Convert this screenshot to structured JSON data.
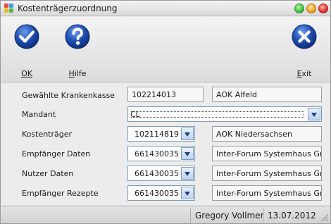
{
  "window": {
    "title": "Kostenträgerzuordnung",
    "controls": [
      "minimize",
      "maximize",
      "close"
    ]
  },
  "toolbar": {
    "ok_label": "OK",
    "help_label": "Hilfe",
    "exit_label": "Exit",
    "ok_icon": "check-icon",
    "help_icon": "question-icon",
    "exit_icon": "close-icon"
  },
  "form": {
    "krankenkasse": {
      "label": "Gewählte Krankenkasse",
      "ik": "102214013",
      "name": "AOK Alfeld"
    },
    "mandant": {
      "label": "Mandant",
      "value": "CL"
    },
    "kostentraeger": {
      "label": "Kostenträger",
      "ik": "102114819",
      "name": "AOK Niedersachsen"
    },
    "empfaenger_daten": {
      "label": "Empfänger Daten",
      "ik": "661430035",
      "name": "Inter-Forum Systemhaus Gm"
    },
    "nutzer_daten": {
      "label": "Nutzer Daten",
      "ik": "661430035",
      "name": "Inter-Forum Systemhaus Gm"
    },
    "empfaenger_rezepte": {
      "label": "Empfänger Rezepte",
      "ik": "661430035",
      "name": "Inter-Forum Systemhaus Gm"
    }
  },
  "statusbar": {
    "user": "Gregory Vollmer",
    "date": "13.07.2012"
  },
  "colors": {
    "toolbar_icon_blue": "#1f4fb4",
    "close_button": "#e0312b",
    "maximize_button": "#f3a21d",
    "minimize_button": "#3fbf3f"
  }
}
